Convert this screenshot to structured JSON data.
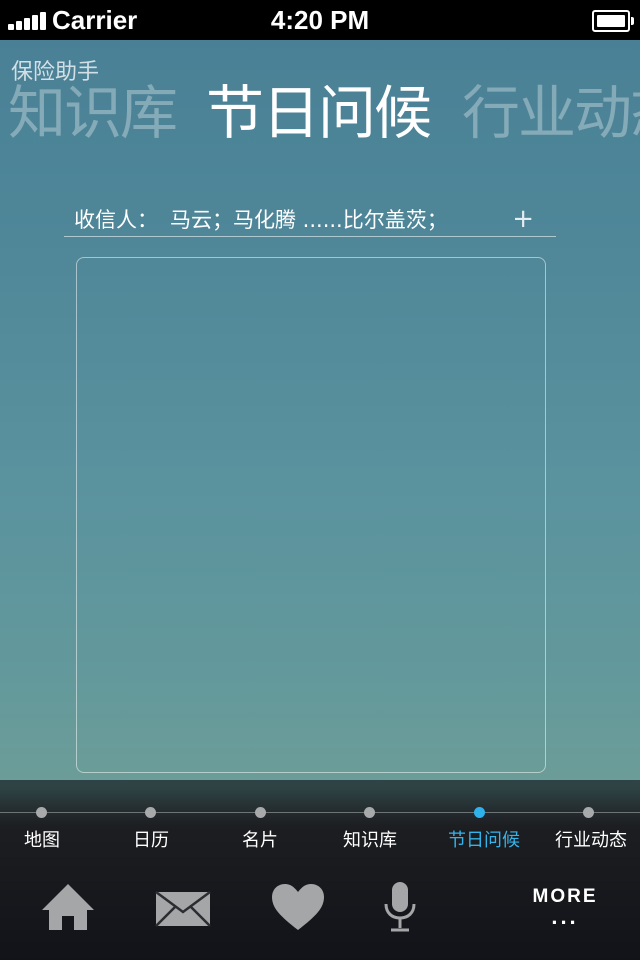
{
  "status_bar": {
    "carrier": "Carrier",
    "time": "4:20 PM"
  },
  "header": {
    "app_name": "保险助手",
    "tabs": {
      "prev": "知识库",
      "current": "节日问候",
      "next": "行业动态"
    }
  },
  "recipient": {
    "label": "收信人：",
    "values": "马云；马化腾  ......比尔盖茨；",
    "add": "+"
  },
  "message_box": {
    "value": ""
  },
  "nav_timeline": {
    "items": [
      {
        "label": "地图"
      },
      {
        "label": "日历"
      },
      {
        "label": "名片"
      },
      {
        "label": "知识库"
      },
      {
        "label": "节日问候"
      },
      {
        "label": "行业动态"
      }
    ],
    "active_index": 4,
    "active_color": "#2fb1ea"
  },
  "tab_bar": {
    "icons": [
      "home-icon",
      "mail-icon",
      "heart-icon",
      "microphone-icon"
    ],
    "more_label": "MORE",
    "more_dots": "..."
  }
}
